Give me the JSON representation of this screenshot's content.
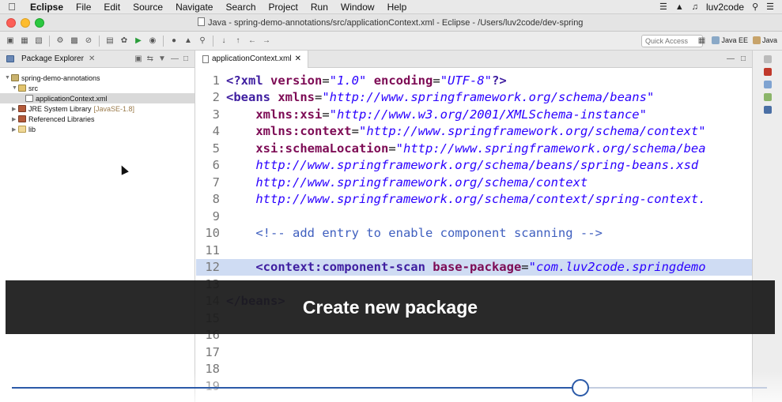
{
  "menubar": {
    "items": [
      "Eclipse",
      "File",
      "Edit",
      "Source",
      "Navigate",
      "Search",
      "Project",
      "Run",
      "Window",
      "Help"
    ],
    "user": "luv2code"
  },
  "window": {
    "title": "Java - spring-demo-annotations/src/applicationContext.xml - Eclipse - /Users/luv2code/dev-spring"
  },
  "toolbar": {
    "quick_access_placeholder": "Quick Access",
    "perspective_java_ee": "Java EE",
    "perspective_java": "Java"
  },
  "package_explorer": {
    "title": "Package Explorer",
    "tree": [
      {
        "label": "spring-demo-annotations",
        "icon": "project-icon",
        "level": 0,
        "expanded": true,
        "selected": false,
        "extra": ""
      },
      {
        "label": "src",
        "icon": "source-folder-icon",
        "level": 1,
        "expanded": true,
        "selected": false,
        "extra": ""
      },
      {
        "label": "applicationContext.xml",
        "icon": "xml-file-icon",
        "level": 2,
        "expanded": null,
        "selected": true,
        "extra": ""
      },
      {
        "label": "JRE System Library",
        "icon": "library-icon",
        "level": 1,
        "expanded": false,
        "selected": false,
        "extra": "[JavaSE-1.8]"
      },
      {
        "label": "Referenced Libraries",
        "icon": "library-icon",
        "level": 1,
        "expanded": false,
        "selected": false,
        "extra": ""
      },
      {
        "label": "lib",
        "icon": "folder-icon",
        "level": 1,
        "expanded": false,
        "selected": false,
        "extra": ""
      }
    ]
  },
  "editor": {
    "tab_label": "applicationContext.xml",
    "highlighted_line": 12,
    "lines": [
      {
        "n": "1",
        "parts": [
          [
            "tag",
            "<?xml "
          ],
          [
            "att",
            "version"
          ],
          [
            "pun",
            "="
          ],
          [
            "str",
            "\"1.0\""
          ],
          [
            "pun",
            " "
          ],
          [
            "att",
            "encoding"
          ],
          [
            "pun",
            "="
          ],
          [
            "str",
            "\"UTF-8\""
          ],
          [
            "tag",
            "?>"
          ]
        ]
      },
      {
        "n": "2",
        "parts": [
          [
            "tag",
            "<beans "
          ],
          [
            "att",
            "xmlns"
          ],
          [
            "pun",
            "="
          ],
          [
            "str",
            "\"http://www.springframework.org/schema/beans\""
          ]
        ]
      },
      {
        "n": "3",
        "parts": [
          [
            "pun",
            "    "
          ],
          [
            "att",
            "xmlns:xsi"
          ],
          [
            "pun",
            "="
          ],
          [
            "str",
            "\"http://www.w3.org/2001/XMLSchema-instance\""
          ]
        ]
      },
      {
        "n": "4",
        "parts": [
          [
            "pun",
            "    "
          ],
          [
            "att",
            "xmlns:context"
          ],
          [
            "pun",
            "="
          ],
          [
            "str",
            "\"http://www.springframework.org/schema/context\""
          ]
        ]
      },
      {
        "n": "5",
        "parts": [
          [
            "pun",
            "    "
          ],
          [
            "att",
            "xsi:schemaLocation"
          ],
          [
            "pun",
            "="
          ],
          [
            "str",
            "\"http://www.springframework.org/schema/bea"
          ]
        ]
      },
      {
        "n": "6",
        "parts": [
          [
            "pun",
            "    "
          ],
          [
            "str",
            "http://www.springframework.org/schema/beans/spring-beans.xsd"
          ]
        ]
      },
      {
        "n": "7",
        "parts": [
          [
            "pun",
            "    "
          ],
          [
            "str",
            "http://www.springframework.org/schema/context"
          ]
        ]
      },
      {
        "n": "8",
        "parts": [
          [
            "pun",
            "    "
          ],
          [
            "str",
            "http://www.springframework.org/schema/context/spring-context."
          ]
        ]
      },
      {
        "n": "9",
        "parts": []
      },
      {
        "n": "10",
        "parts": [
          [
            "pun",
            "    "
          ],
          [
            "cmt",
            "<!-- add entry to enable component scanning -->"
          ]
        ]
      },
      {
        "n": "11",
        "parts": []
      },
      {
        "n": "12",
        "parts": [
          [
            "pun",
            "    "
          ],
          [
            "tag",
            "<context:component-scan "
          ],
          [
            "att",
            "base-package"
          ],
          [
            "pun",
            "="
          ],
          [
            "str",
            "\"com.luv2code.springdemo"
          ]
        ]
      },
      {
        "n": "13",
        "parts": []
      },
      {
        "n": "14",
        "parts": [
          [
            "tag",
            "</beans>"
          ]
        ]
      },
      {
        "n": "15",
        "parts": []
      },
      {
        "n": "16",
        "parts": []
      },
      {
        "n": "17",
        "parts": []
      },
      {
        "n": "18",
        "parts": []
      },
      {
        "n": "19",
        "parts": []
      }
    ]
  },
  "caption": {
    "text": "Create new package"
  },
  "video": {
    "progress": 0.7529
  }
}
